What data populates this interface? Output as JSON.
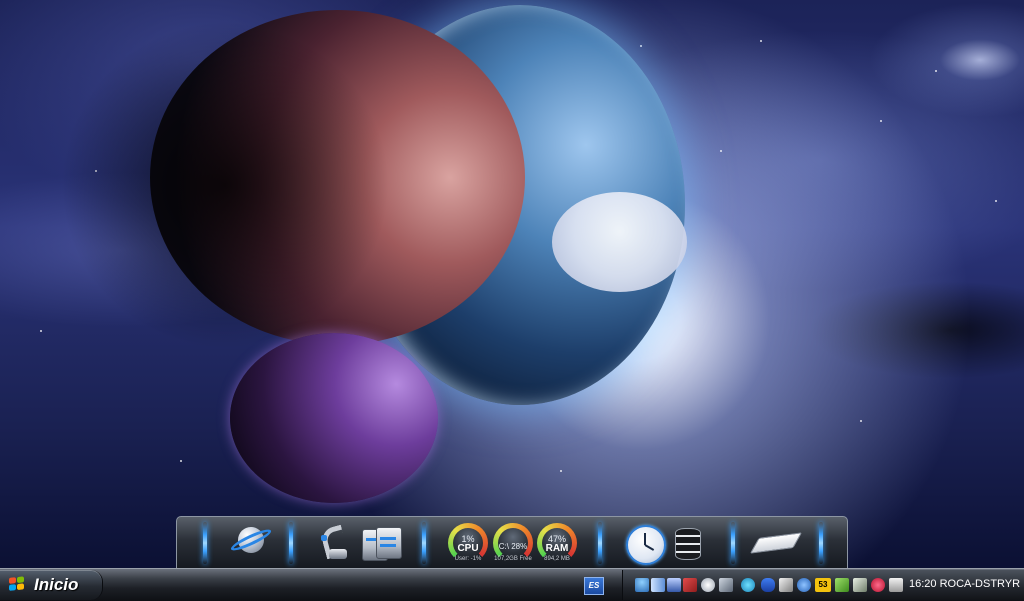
{
  "taskbar": {
    "start_label": "Inicio",
    "language": "ES",
    "clock": "16:20",
    "computer_name": "ROCA-DSTRYR",
    "tray_icons": [
      "network-icon",
      "wireless-icon",
      "display-icon",
      "remove-hardware-icon",
      "speaker-icon",
      "network-tools-icon",
      "sync-icon",
      "bluetooth-icon",
      "pen-icon",
      "settings-icon",
      "number-badge-icon",
      "download-icon",
      "graph-icon",
      "antivirus-icon",
      "printer-icon"
    ],
    "tray_badge": "53"
  },
  "dock": {
    "items": [
      "saturn-browser-icon",
      "scanner-icon",
      "drives-icon",
      "cpu-gauge",
      "disk-gauge",
      "ram-gauge",
      "clock-icon",
      "cylinder-icon",
      "eraser-icon"
    ],
    "gauges": {
      "cpu": {
        "value": "1%",
        "name": "CPU",
        "sub": "User: -1%"
      },
      "disk": {
        "value": "C:\\ 28%",
        "sub": "107,2GB Free"
      },
      "ram": {
        "value": "47%",
        "name": "RAM",
        "sub": "894,2 MB"
      }
    },
    "accent_color": "#3aa0ff"
  }
}
